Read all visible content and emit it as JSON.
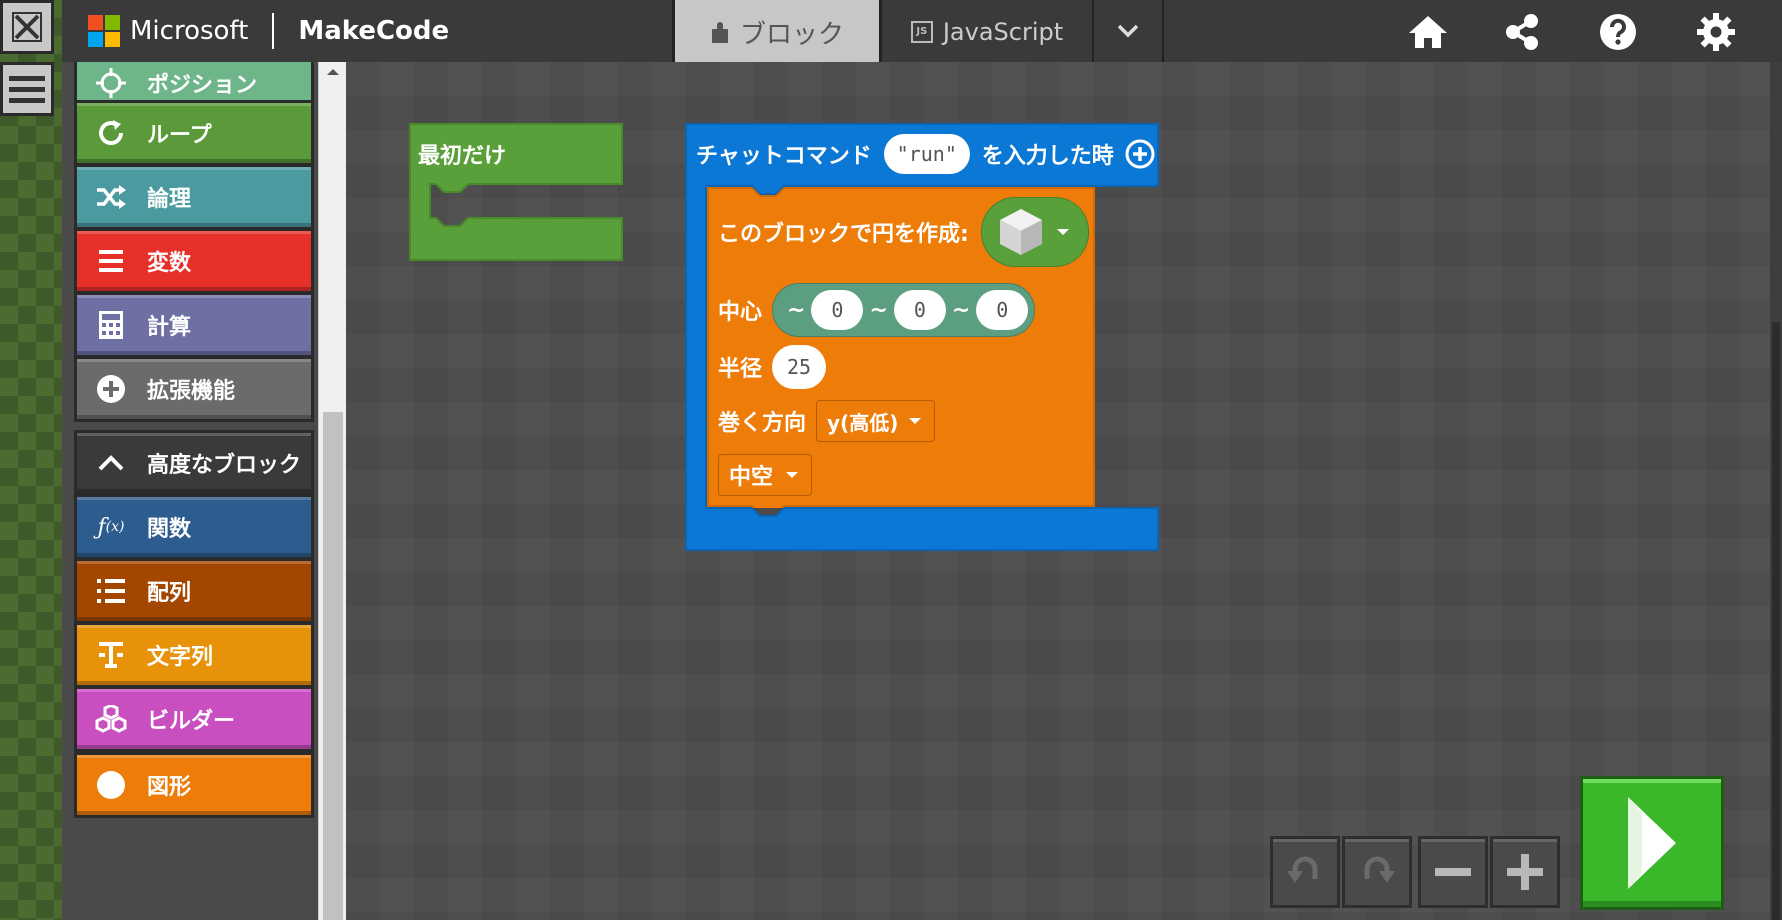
{
  "header": {
    "brand_ms": "Microsoft",
    "brand_app": "MakeCode",
    "tab_blocks": "ブロック",
    "tab_js": "JavaScript",
    "js_badge": "JS"
  },
  "toolbox": {
    "items": [
      {
        "label": "ポジション",
        "color": "#6fb58a",
        "icon": "crosshair-icon"
      },
      {
        "label": "ループ",
        "color": "#5a9a3a",
        "icon": "loop-icon"
      },
      {
        "label": "論理",
        "color": "#4a9aa0",
        "icon": "shuffle-icon"
      },
      {
        "label": "変数",
        "color": "#e8302a",
        "icon": "list-lines-icon"
      },
      {
        "label": "計算",
        "color": "#6e70a4",
        "icon": "calculator-icon"
      },
      {
        "label": "拡張機能",
        "color": "#6b6b6b",
        "icon": "plus-circle-icon"
      },
      {
        "label": "高度なブロック",
        "color": "#3a3a3a",
        "icon": "chevron-up-icon"
      },
      {
        "label": "関数",
        "color": "#2d5c8e",
        "icon": "function-icon"
      },
      {
        "label": "配列",
        "color": "#a34700",
        "icon": "numbered-list-icon"
      },
      {
        "label": "文字列",
        "color": "#e8920a",
        "icon": "text-icon"
      },
      {
        "label": "ビルダー",
        "color": "#c94ec0",
        "icon": "cubes-icon"
      },
      {
        "label": "図形",
        "color": "#ee7c09",
        "icon": "circle-icon"
      }
    ]
  },
  "workspace": {
    "on_start": {
      "label": "最初だけ",
      "color": "#5aa03a"
    },
    "chat_block": {
      "label": "チャットコマンド",
      "command": "run",
      "suffix": "を入力した時",
      "color": "#0b78d6"
    },
    "circle_block": {
      "label": "このブロックで円を作成:",
      "center_label": "中心",
      "tilde": "~",
      "x": "0",
      "y": "0",
      "z": "0",
      "radius_label": "半径",
      "radius": "25",
      "orientation_label": "巻く方向",
      "orientation": "y(高低)",
      "fill_mode": "中空",
      "color": "#ee7c09"
    }
  }
}
